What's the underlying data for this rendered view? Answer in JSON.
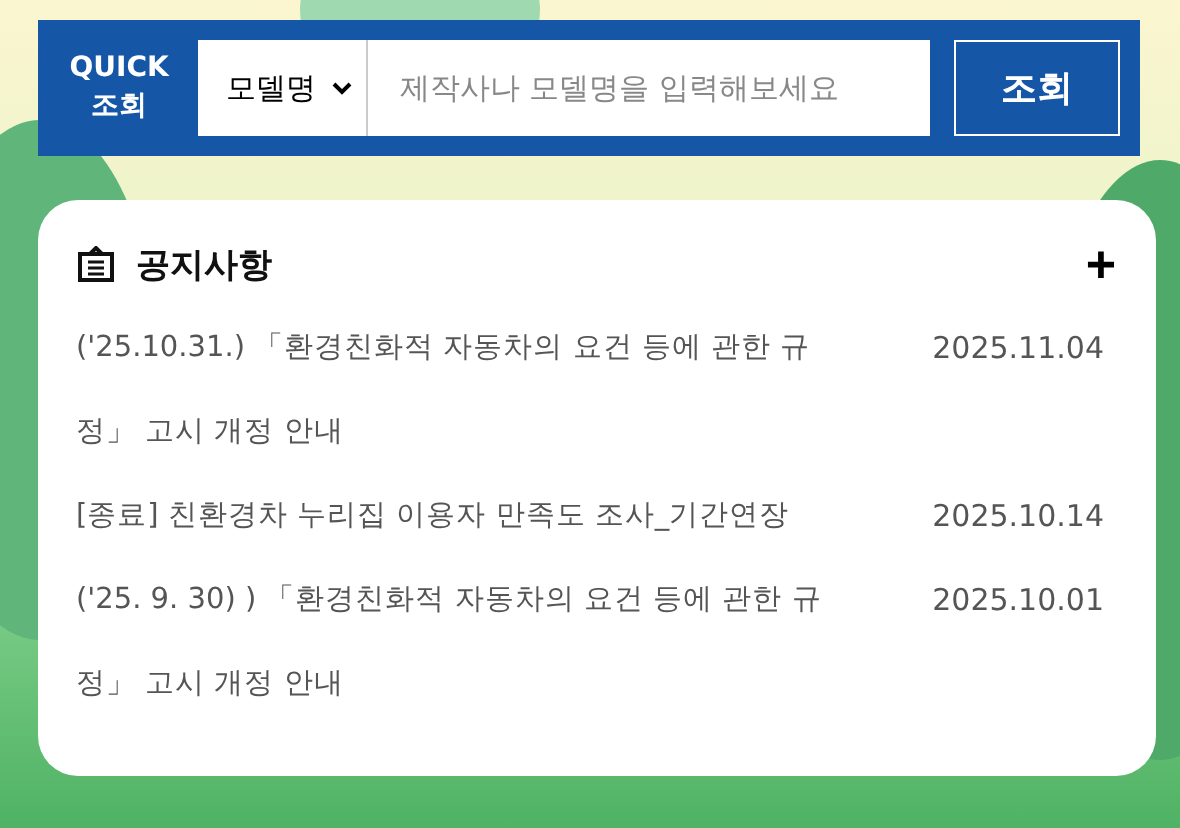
{
  "quick_search": {
    "label_top": "QUICK",
    "label_bottom": "조회",
    "filter": "모델명",
    "placeholder": "제작사나 모델명을 입력해보세요",
    "button": "조회"
  },
  "notices": {
    "title": "공지사항",
    "more": "+",
    "items": [
      {
        "title": "('25.10.31.) 「환경친화적 자동차의 요건 등에 관한 규정」 고시 개정 안내",
        "date": "2025.11.04"
      },
      {
        "title": "[종료] 친환경차 누리집 이용자 만족도 조사_기간연장",
        "date": "2025.10.14"
      },
      {
        "title": "('25. 9. 30) ) 「환경친화적 자동차의 요건 등에 관한 규정」 고시 개정 안내",
        "date": "2025.10.01"
      }
    ]
  }
}
